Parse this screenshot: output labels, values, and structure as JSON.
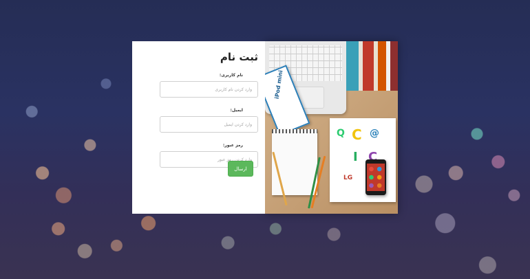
{
  "signup": {
    "title": "ثبت نام",
    "username_label": "نام کاربری:",
    "username_placeholder": "وارد کردن نام کاربری",
    "email_label": "ایمیل:",
    "email_placeholder": "وارد کردن ایمیل",
    "password_label": "رمز عبور:",
    "password_placeholder": "وارد کردن رمز عبور",
    "submit_label": "ارسال"
  },
  "photo": {
    "ipad_box_text": "iPod mini",
    "logos": [
      "Q",
      "C",
      "@",
      "I",
      "C",
      "LG"
    ]
  },
  "colors": {
    "submit_button": "#5cb85c",
    "background": "#2a3262"
  }
}
